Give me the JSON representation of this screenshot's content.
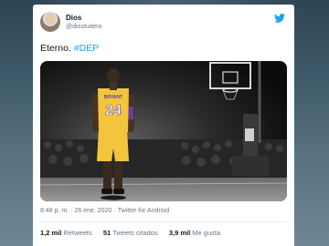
{
  "tweet": {
    "name": "Dios",
    "handle": "@diostuitero",
    "text_plain": "Eterno. ",
    "hashtag": "#DEP",
    "time": "8:48 p. m.",
    "separator": "·",
    "date": "26 ene. 2020",
    "client": "Twitter for Android",
    "retweets_count": "1,2 mil",
    "retweets_label": "Retweets",
    "quotes_count": "51",
    "quotes_label": "Tweets citados",
    "likes_count": "3,9 mil",
    "likes_label": "Me gusta"
  },
  "image": {
    "jersey_name": "BRYANT",
    "jersey_number": "24",
    "jersey_color": "#f2c53d",
    "accent_purple": "#6a3d9a"
  },
  "colors": {
    "link": "#1da1f2",
    "text": "#14171a",
    "muted": "#657786"
  },
  "icons": [
    "avatar",
    "twitter-bird-icon"
  ]
}
